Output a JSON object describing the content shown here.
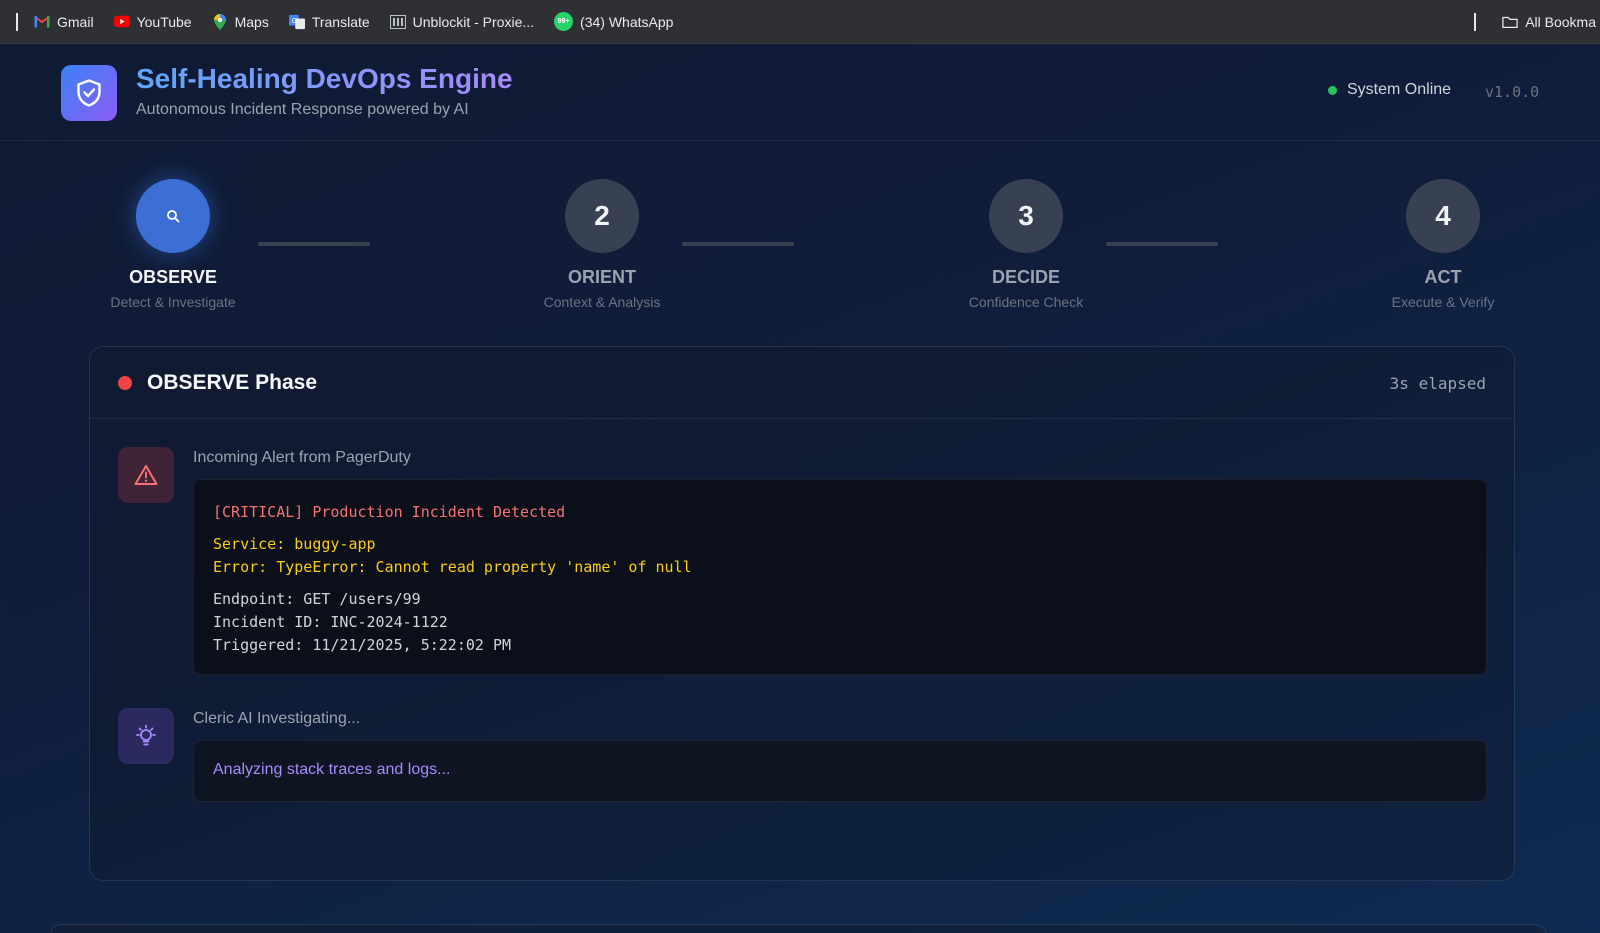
{
  "bookmarks": {
    "items": [
      {
        "label": "Gmail",
        "icon": "gmail-icon"
      },
      {
        "label": "YouTube",
        "icon": "youtube-icon"
      },
      {
        "label": "Maps",
        "icon": "maps-icon"
      },
      {
        "label": "Translate",
        "icon": "translate-icon"
      },
      {
        "label": "Unblockit - Proxie...",
        "icon": "unblockit-icon"
      },
      {
        "label": "(34) WhatsApp",
        "icon": "whatsapp-icon",
        "badge": "99+"
      }
    ],
    "all_bookmarks": "All Bookma"
  },
  "header": {
    "title": "Self-Healing DevOps Engine",
    "subtitle": "Autonomous Incident Response powered by AI",
    "status": "System Online",
    "version": "v1.0.0"
  },
  "steps": [
    {
      "number": "",
      "name": "OBSERVE",
      "desc": "Detect & Investigate",
      "active": true
    },
    {
      "number": "2",
      "name": "ORIENT",
      "desc": "Context & Analysis",
      "active": false
    },
    {
      "number": "3",
      "name": "DECIDE",
      "desc": "Confidence Check",
      "active": false
    },
    {
      "number": "4",
      "name": "ACT",
      "desc": "Execute & Verify",
      "active": false
    }
  ],
  "phase": {
    "title": "OBSERVE Phase",
    "elapsed": "3s elapsed",
    "alert": {
      "label": "Incoming Alert from PagerDuty",
      "critical": "[CRITICAL] Production Incident Detected",
      "service": "Service: buggy-app",
      "error": "Error: TypeError: Cannot read property 'name' of null",
      "endpoint": "Endpoint: GET /users/99",
      "incident_id": "Incident ID: INC-2024-1122",
      "triggered": "Triggered: 11/21/2025, 5:22:02 PM"
    },
    "ai": {
      "label": "Cleric AI Investigating...",
      "message": "Analyzing stack traces and logs..."
    }
  },
  "colors": {
    "accent_blue": "#3b82f6",
    "accent_purple": "#8b5cf6",
    "critical_red": "#ef4444",
    "warning_yellow": "#facc15",
    "online_green": "#22c55e"
  }
}
